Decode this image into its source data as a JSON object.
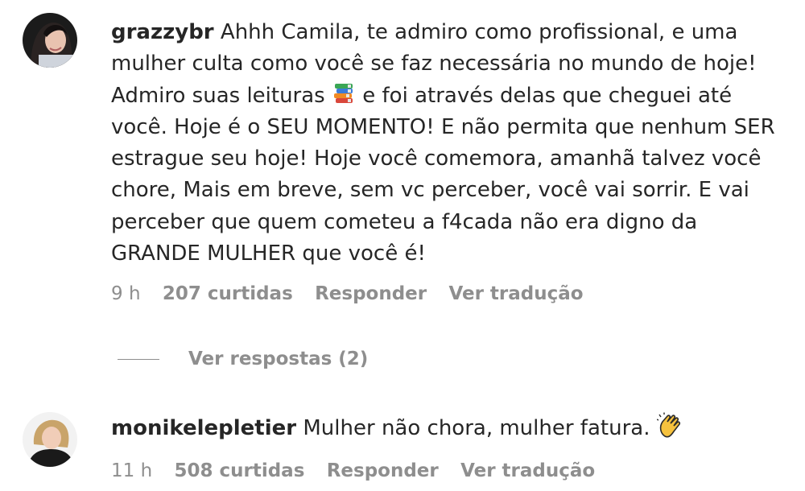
{
  "comments": [
    {
      "username": "grazzybr",
      "text_before_emoji": "Ahhh Camila, te admiro como profissional, e uma mulher culta como você se faz necessária no mundo de hoje! Admiro suas leituras",
      "emoji": "books-icon",
      "text_after_emoji": "e foi através delas que cheguei até você. Hoje é o SEU MOMENTO! E não permita que nenhum SER estrague seu hoje! Hoje você comemora, amanhã talvez você chore, Mais em breve, sem vc perceber, você vai sorrir. E vai perceber que quem cometeu a f4cada não era digno da GRANDE MULHER que você é!",
      "time": "9 h",
      "likes": "207 curtidas",
      "reply_label": "Responder",
      "translate_label": "Ver tradução",
      "view_replies_label": "Ver respostas (2)"
    },
    {
      "username": "monikelepletier",
      "text": "Mulher não chora, mulher fatura.",
      "emoji": "clapping-hands-icon",
      "time": "11 h",
      "likes": "508 curtidas",
      "reply_label": "Responder",
      "translate_label": "Ver tradução"
    }
  ],
  "colors": {
    "text": "#262626",
    "secondary": "#8e8e8e"
  }
}
